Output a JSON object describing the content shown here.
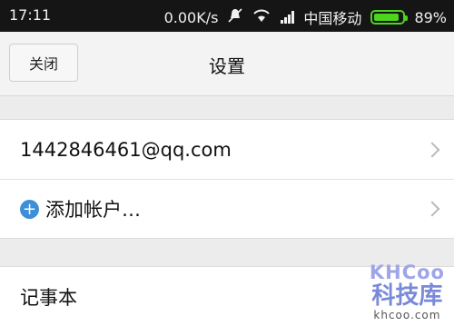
{
  "status_bar": {
    "time": "17:11",
    "speed": "0.00K/s",
    "carrier": "中国移动",
    "battery_percent": "89%",
    "battery_level": 0.89
  },
  "header": {
    "close_label": "关闭",
    "title": "设置"
  },
  "accounts": {
    "email": "1442846461@qq.com",
    "add_account_label": "添加帐户…"
  },
  "notes": {
    "label": "记事本"
  },
  "watermark": {
    "logo": "KHCoo",
    "site_name": "科技库",
    "url": "khcoo.com"
  },
  "colors": {
    "accent_blue": "#3d8fd8",
    "battery_green": "#4cd41f"
  }
}
